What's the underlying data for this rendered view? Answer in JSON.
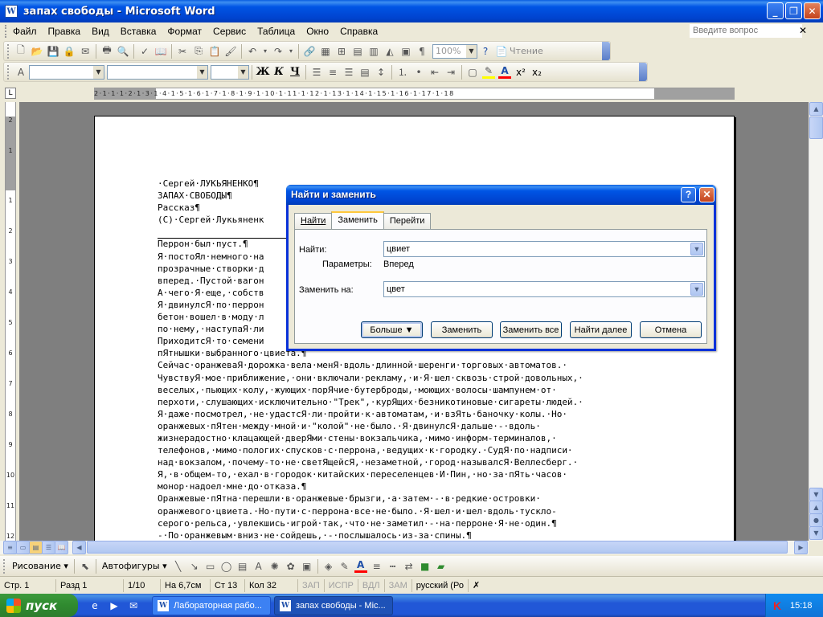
{
  "window": {
    "title": "запах свободы - Microsoft Word",
    "app_icon": "W",
    "buttons": [
      "minimize-icon",
      "restore-icon",
      "close-icon"
    ]
  },
  "menubar": {
    "items": [
      "Файл",
      "Правка",
      "Вид",
      "Вставка",
      "Формат",
      "Сервис",
      "Таблица",
      "Окно",
      "Справка"
    ],
    "ask_placeholder": "Введите вопрос"
  },
  "standard_toolbar": {
    "zoom": "100%",
    "read_label": "Чтение"
  },
  "formatting_toolbar": {
    "bold": "Ж",
    "italic": "К",
    "underline": "Ч",
    "style_value": "",
    "font_value": "",
    "size_value": "",
    "colors": {
      "highlight": "#ffff00",
      "font_color": "#ff0000"
    }
  },
  "ruler": {
    "numbers": "2·1·1·1·2·1·3·1·4·1·5·1·6·1·7·1·8·1·9·1·10·1·11·1·12·1·13·1·14·1·15·1·16·1·17·1·18",
    "vertical_numbers": [
      "2",
      "1",
      "1",
      "2",
      "3",
      "4",
      "5",
      "6",
      "7",
      "8",
      "9",
      "10",
      "11",
      "12"
    ]
  },
  "document": {
    "lines": [
      "·Сергей·ЛУКЬЯНЕНКО¶",
      "ЗАПАХ·СВОБОДЫ¶",
      "Рассказ¶",
      "(С)·Сергей·Лукьяненк",
      "",
      "Перрон·был·пуст.¶",
      "Я·постоЯл·немного·на",
      "прозрачные·створки·д",
      "вперед.·Пустой·вагон",
      "А·чего·Я·еще,·собств",
      "Я·двинулсЯ·по·перрон",
      "бетон·вошел·в·моду·л",
      "по·нему,·наступаЯ·ли",
      "ПриходитсЯ·то·семени",
      "пЯтнышки·выбранного·цвиета.¶",
      "Сейчас·оранжеваЯ·дорожка·вела·менЯ·вдоль·длинной·шеренги·торговых·автоматов.·",
      "ЧувствуЯ·мое·приближение,·они·включали·рекламу,·и·Я·шел·сквозь·строй·довольных,·",
      "веселых,·пьющих·колу,·жующих·порЯчие·бутерброды,·моющих·волосы·шампунем·от·",
      "перхоти,·слушающих·исключительно·\"Трек\",·курЯщих·безникотиновые·сигареты·людей.·",
      "Я·даже·посмотрел,·не·удастсЯ·ли·пройти·к·автоматам,·и·взЯть·баночку·колы.·Но·",
      "оранжевых·пЯтен·между·мной·и·\"колой\"·не·было.·Я·двинулсЯ·дальше·-·вдоль·",
      "жизнерадостно·клацающей·дверЯми·стены·вокзальчика,·мимо·информ-терминалов,·",
      "телефонов,·мимо·пологих·спусков·с·перрона,·ведущих·к·городку.·СудЯ·по·надписи·",
      "над·вокзалом,·почему-то·не·светЯщейсЯ,·незаметной,·город·называлсЯ·Веллесберг.·",
      "Я,·в·общем-то,·ехал·в·городок·китайских·переселенцев·И·Пин,·но·за·пЯть·часов·",
      "монор·надоел·мне·до·отказа.¶",
      "Оранжевые·пЯтна·перешли·в·оранжевые·брызги,·а·затем·-·в·редкие·островки·",
      "оранжевого·цвиета.·Но·пути·с·перрона·все·не·было.·Я·шел·и·шел·вдоль·тускло-",
      "серого·рельса,·увлекшись·игрой·так,·что·не·заметил·-·на·перроне·Я·не·один.¶",
      "-·По·оранжевым·вниз·не·сойдешь,·-·послышалось·из-за·спины.¶"
    ]
  },
  "dialog": {
    "title": "Найти и заменить",
    "help_label": "?",
    "tabs": [
      "Найти",
      "Заменить",
      "Перейти"
    ],
    "active_tab": 1,
    "find_label": "Найти:",
    "find_value": "цвиет",
    "params_label": "Параметры:",
    "params_value": "Вперед",
    "replace_label": "Заменить на:",
    "replace_value": "цвет",
    "buttons": {
      "more": "Больше ▼",
      "replace": "Заменить",
      "replace_all": "Заменить все",
      "find_next": "Найти далее",
      "cancel": "Отмена"
    }
  },
  "drawing_toolbar": {
    "draw_label": "Рисование ▾",
    "autoshapes_label": "Автофигуры ▾"
  },
  "statusbar": {
    "page": "Стр. 1",
    "section": "Разд 1",
    "pages": "1/10",
    "at": "На 6,7см",
    "line": "Ст 13",
    "col": "Кол 32",
    "rec": "ЗАП",
    "trk": "ИСПР",
    "ext": "ВДЛ",
    "ovr": "ЗАМ",
    "lang": "русский (Ро"
  },
  "taskbar": {
    "start_label": "пуск",
    "tasks": [
      "Лабораторная рабо...",
      "запах свободы - Mic..."
    ],
    "active_task": 1,
    "clock": "15:18"
  }
}
